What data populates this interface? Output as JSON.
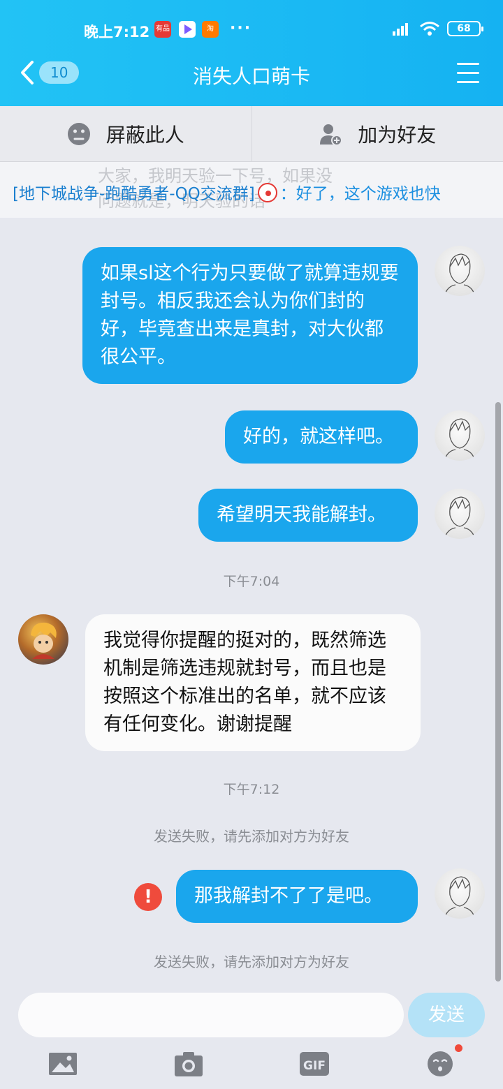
{
  "status_bar": {
    "time": "晚上7:12",
    "app_icons": [
      "有品",
      "",
      "淘"
    ],
    "more": "···",
    "battery": "68"
  },
  "nav": {
    "back_count": "10",
    "title": "消失人口萌卡"
  },
  "actions": {
    "block_label": "屏蔽此人",
    "add_friend_label": "加为好友"
  },
  "notice": {
    "ghost_line1": "大家，我明天验一下号，如果没",
    "ghost_line2": "问题就是，明天验的话",
    "group": "[地下城战争-跑酷勇者-QQ交流群]",
    "message": "：好了，这个游戏也快"
  },
  "messages": [
    {
      "side": "out",
      "text": "如果sl这个行为只要做了就算违规要封号。相反我还会认为你们封的好，毕竟查出来是真封，对大伙都很公平。"
    },
    {
      "side": "out",
      "text": "好的，就这样吧。"
    },
    {
      "side": "out",
      "text": "希望明天我能解封。"
    },
    {
      "side": "in",
      "text": "我觉得你提醒的挺对的，既然筛选机制是筛选违规就封号，而且也是按照这个标准出的名单，就不应该有任何变化。谢谢提醒"
    },
    {
      "side": "out",
      "text": "那我解封不了了是吧。"
    }
  ],
  "timestamps": [
    "下午7:04",
    "下午7:12"
  ],
  "system_notes": [
    "发送失败，请先添加对方为好友",
    "发送失败，请先添加对方为好友"
  ],
  "error_mark": "!",
  "input": {
    "placeholder": "",
    "send_label": "发送"
  },
  "toolbar_icons": [
    "image-icon",
    "camera-icon",
    "gif-icon",
    "emoji-icon"
  ],
  "toolbar_gif_label": "GIF",
  "colors": {
    "header": "#15b2f2",
    "outgoing_bubble": "#1aa6ed",
    "incoming_bubble": "#fbfbfb",
    "error": "#ef4b3c"
  }
}
